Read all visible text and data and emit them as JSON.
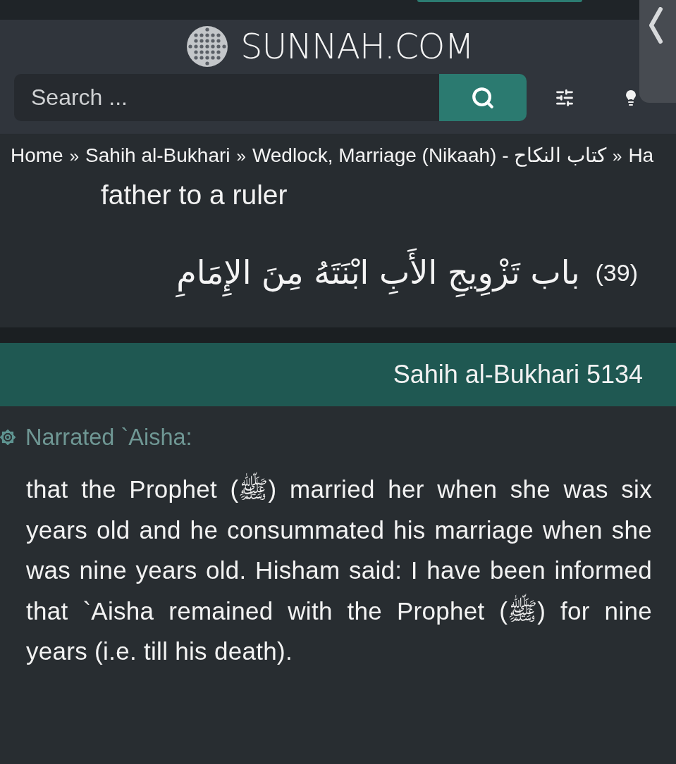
{
  "header": {
    "logo": {
      "text": "SUNNAH.COM"
    },
    "search": {
      "placeholder": "Search ..."
    }
  },
  "breadcrumb": {
    "home": "Home",
    "separator_1": "»",
    "collection": "Sahih al-Bukhari",
    "separator_2": "»",
    "book": "Wedlock, Marriage (Nikaah) - كتاب النكاح",
    "separator_3": "»",
    "crumb_4": "Ha"
  },
  "chapter": {
    "english_title": "father to a ruler",
    "number": "(39)",
    "arabic_title": "باب تَزْوِيجِ الأَبِ ابْنَتَهُ مِنَ الإِمَامِ"
  },
  "hadith": {
    "reference": "Sahih al-Bukhari 5134",
    "narrator": "Narrated `Aisha:",
    "text": "that the Prophet (ﷺ) married her when she was six years old and he consummated his marriage when she was nine years old. Hisham said: I have been informed that `Aisha remained with the Prophet (ﷺ) for nine years (i.e. till his death)."
  }
}
